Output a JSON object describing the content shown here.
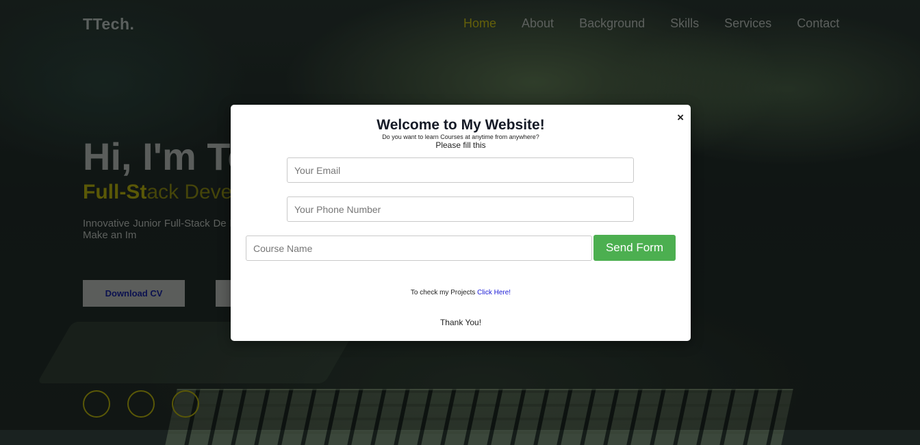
{
  "header": {
    "logo": "TTech.",
    "nav": [
      {
        "label": "Home",
        "active": true
      },
      {
        "label": "About"
      },
      {
        "label": "Background"
      },
      {
        "label": "Skills"
      },
      {
        "label": "Services"
      },
      {
        "label": "Contact"
      }
    ]
  },
  "hero": {
    "title": "Hi, I'm Te",
    "subtitle_visible_part": "Full-St",
    "subtitle_dim_part": "ack Deve",
    "description": "Innovative Junior Full-Stack De React, Angular, Node.js, Mong Solutions | Ready to Make an Im",
    "download_cv_label": "Download CV"
  },
  "modal": {
    "title": "Welcome to My Website!",
    "question": "Do you want to learn Courses at anytime from anywhere?",
    "fill_prompt": "Please fill this",
    "email_placeholder": "Your Email",
    "phone_placeholder": "Your Phone Number",
    "course_placeholder": "Course Name",
    "send_label": "Send Form",
    "projects_text": "To check my Projects",
    "projects_link": "Click Here!",
    "thanks": "Thank You!",
    "close_glyph": "×"
  },
  "colors": {
    "accent_olive": "#8a870c",
    "send_green": "#4caf50",
    "link_blue": "#1a1ad6"
  }
}
